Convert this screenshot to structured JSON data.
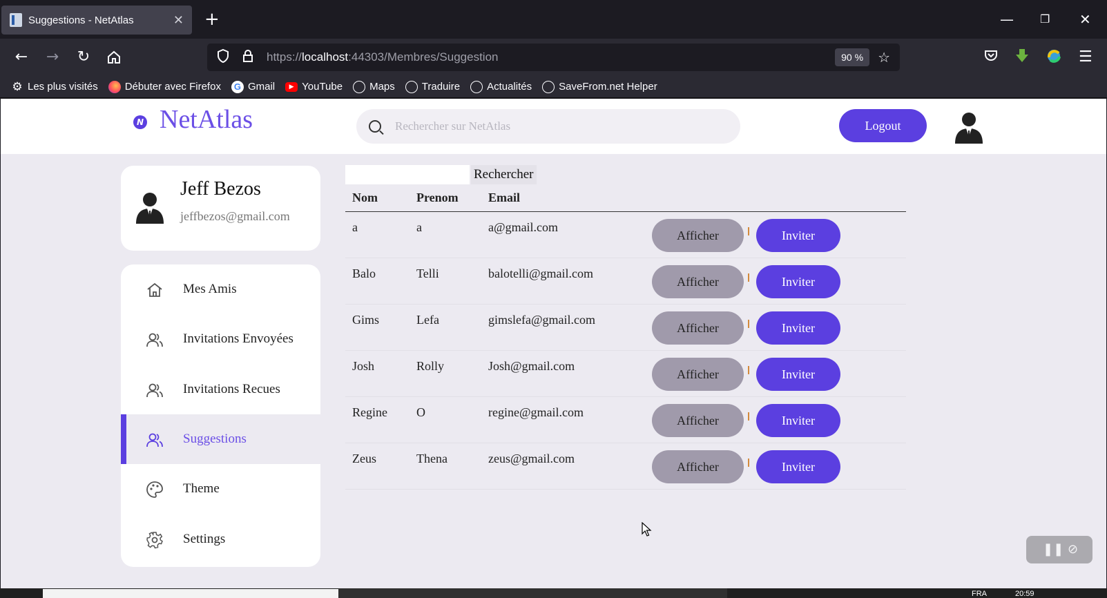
{
  "browser": {
    "tab_title": "Suggestions - NetAtlas",
    "url_prefix": "https://",
    "url_host": "localhost",
    "url_path": ":44303/Membres/Suggestion",
    "zoom": "90 %",
    "bookmarks": [
      {
        "label": "Les plus visités",
        "icon": "gear-icon"
      },
      {
        "label": "Débuter avec Firefox",
        "icon": "firefox-icon"
      },
      {
        "label": "Gmail",
        "icon": "google-icon"
      },
      {
        "label": "YouTube",
        "icon": "youtube-icon"
      },
      {
        "label": "Maps",
        "icon": "globe-icon"
      },
      {
        "label": "Traduire",
        "icon": "globe-icon"
      },
      {
        "label": "Actualités",
        "icon": "globe-icon"
      },
      {
        "label": "SaveFrom.net Helper",
        "icon": "globe-icon"
      }
    ]
  },
  "app": {
    "logo_text": "NetAtlas",
    "search_placeholder": "Rechercher sur NetAtlas",
    "logout_label": "Logout"
  },
  "profile": {
    "name": "Jeff Bezos",
    "email": "jeffbezos@gmail.com"
  },
  "menu": [
    {
      "label": "Mes Amis",
      "icon": "home-icon",
      "active": false
    },
    {
      "label": "Invitations Envoyées",
      "icon": "users-icon",
      "active": false
    },
    {
      "label": "Invitations Recues",
      "icon": "users-icon",
      "active": false
    },
    {
      "label": "Suggestions",
      "icon": "users-icon",
      "active": true
    },
    {
      "label": "Theme",
      "icon": "palette-icon",
      "active": false
    },
    {
      "label": "Settings",
      "icon": "gear-icon",
      "active": false
    }
  ],
  "filter": {
    "value": "",
    "button_label": "Rechercher"
  },
  "table": {
    "headers": [
      "Nom",
      "Prenom",
      "Email"
    ],
    "action_afficher": "Afficher",
    "action_inviter": "Inviter",
    "separator": "|",
    "rows": [
      {
        "nom": "a",
        "prenom": "a",
        "email": "a@gmail.com"
      },
      {
        "nom": "Balo",
        "prenom": "Telli",
        "email": "balotelli@gmail.com"
      },
      {
        "nom": "Gims",
        "prenom": "Lefa",
        "email": "gimslefa@gmail.com"
      },
      {
        "nom": "Josh",
        "prenom": "Rolly",
        "email": "Josh@gmail.com"
      },
      {
        "nom": "Regine",
        "prenom": "O",
        "email": "regine@gmail.com"
      },
      {
        "nom": "Zeus",
        "prenom": "Thena",
        "email": "zeus@gmail.com"
      }
    ]
  },
  "taskbar": {
    "lang": "FRA",
    "time": "20:59"
  },
  "colors": {
    "accent": "#5b3fe0",
    "afficher_bg": "#a09aab",
    "page_bg": "#eceaf1"
  }
}
